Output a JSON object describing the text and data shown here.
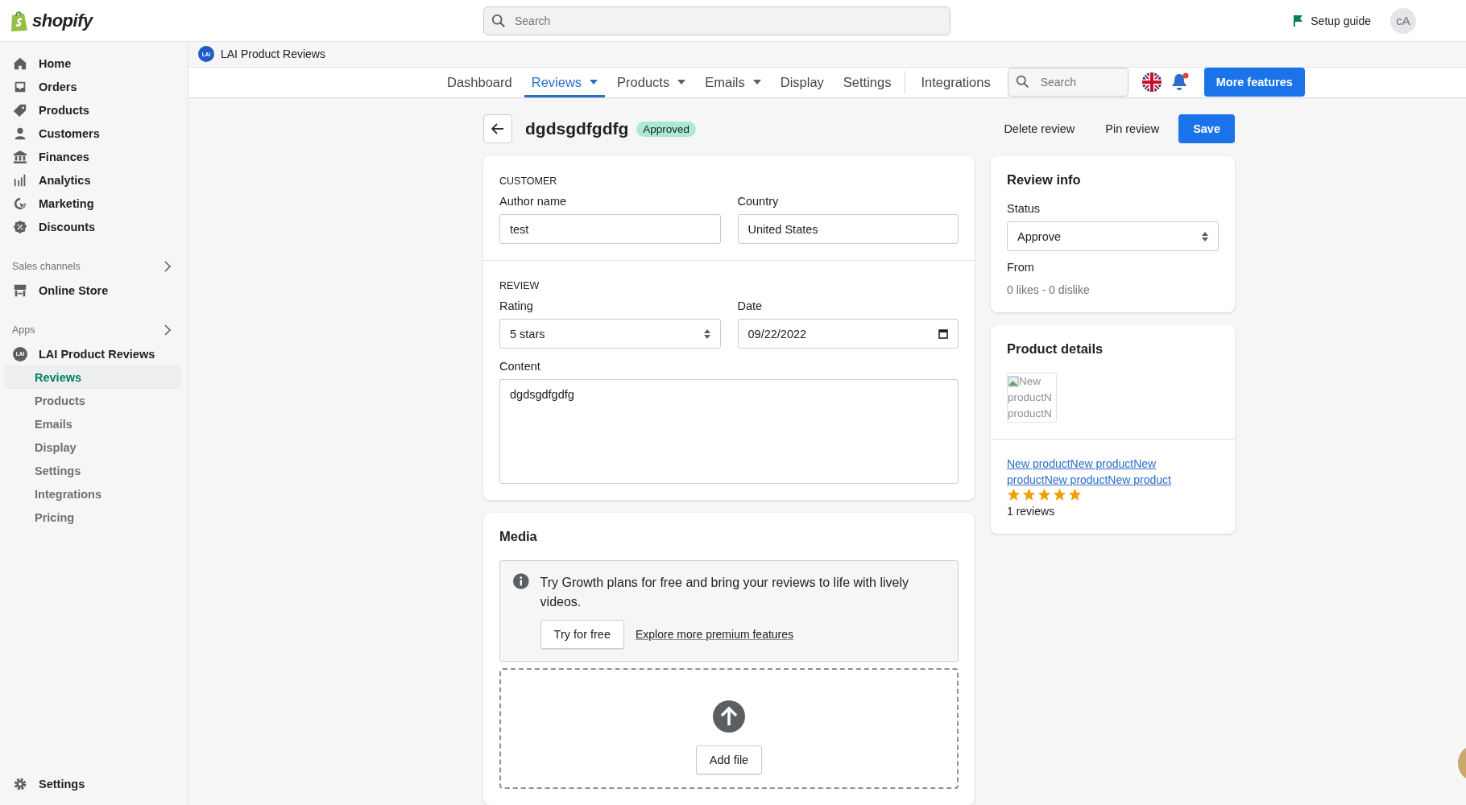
{
  "topbar": {
    "logo": "shopify",
    "search": {
      "placeholder": "Search"
    },
    "setup_guide": "Setup guide",
    "avatar": "cA"
  },
  "sidebar": {
    "items": [
      {
        "label": "Home",
        "selected": false
      },
      {
        "label": "Orders",
        "selected": false
      },
      {
        "label": "Products",
        "selected": false
      },
      {
        "label": "Customers",
        "selected": false
      },
      {
        "label": "Finances",
        "selected": false
      },
      {
        "label": "Analytics",
        "selected": false
      },
      {
        "label": "Marketing",
        "selected": false
      },
      {
        "label": "Discounts",
        "selected": false
      }
    ],
    "sales_channels": {
      "title": "Sales channels",
      "items": [
        {
          "label": "Online Store"
        }
      ]
    },
    "apps": {
      "title": "Apps",
      "app": {
        "label": "LAI Product Reviews",
        "badge": "LAI",
        "children": [
          {
            "label": "Reviews",
            "selected": true
          },
          {
            "label": "Products",
            "selected": false
          },
          {
            "label": "Emails",
            "selected": false
          },
          {
            "label": "Display",
            "selected": false
          },
          {
            "label": "Settings",
            "selected": false
          },
          {
            "label": "Integrations",
            "selected": false
          },
          {
            "label": "Pricing",
            "selected": false
          }
        ]
      }
    },
    "settings": "Settings"
  },
  "app_header": {
    "badge": "LAI",
    "title": "LAI Product Reviews"
  },
  "nav": {
    "tabs": [
      {
        "label": "Dashboard",
        "selected": false,
        "dropdown": false
      },
      {
        "label": "Reviews",
        "selected": true,
        "dropdown": true
      },
      {
        "label": "Products",
        "selected": false,
        "dropdown": true
      },
      {
        "label": "Emails",
        "selected": false,
        "dropdown": true
      },
      {
        "label": "Display",
        "selected": false,
        "dropdown": false
      },
      {
        "label": "Settings",
        "selected": false,
        "dropdown": false
      },
      {
        "label": "Integrations",
        "selected": false,
        "dropdown": false
      }
    ],
    "search": {
      "placeholder": "Search"
    },
    "notification": true,
    "more_features": "More features"
  },
  "page": {
    "title": "dgdsgdfgdfg",
    "status": "Approved",
    "actions": [
      "Delete review",
      "Pin review"
    ],
    "save": "Save"
  },
  "customer": {
    "heading": "CUSTOMER",
    "author_label": "Author name",
    "author": "test",
    "country_label": "Country",
    "country": "United States"
  },
  "review": {
    "heading": "REVIEW",
    "rating_label": "Rating",
    "rating": "5 stars",
    "date_label": "Date",
    "date": "09/22/2022",
    "content_label": "Content",
    "content": "dgdsgdfgdfg"
  },
  "media": {
    "title": "Media",
    "banner": {
      "text": "Try Growth plans for free and bring your reviews to life with lively videos.",
      "button": "Try for free",
      "link": "Explore more premium features"
    },
    "add_file": "Add file"
  },
  "review_info": {
    "title": "Review info",
    "status_label": "Status",
    "status": "Approve",
    "from_label": "From",
    "votes": "0 likes - 0 dislike"
  },
  "product_details": {
    "title": "Product details",
    "image_alt_lines": [
      "New",
      "productN",
      "productN"
    ],
    "product_link": "New productNew productNew productNew productNew product",
    "stars": 5,
    "reviews": "1 reviews"
  }
}
